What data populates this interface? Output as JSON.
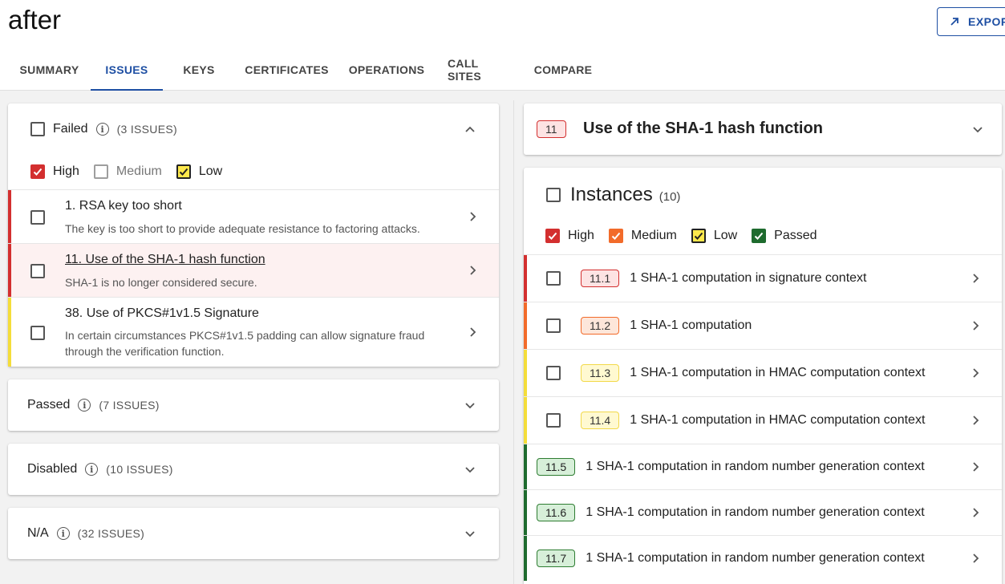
{
  "header": {
    "title": "after",
    "export_label": "EXPOR",
    "tabs": [
      {
        "label": "SUMMARY"
      },
      {
        "label": "ISSUES"
      },
      {
        "label": "KEYS"
      },
      {
        "label": "CERTIFICATES"
      },
      {
        "label": "OPERATIONS"
      },
      {
        "label": "CALL SITES"
      },
      {
        "label": "COMPARE"
      }
    ],
    "active_tab": "ISSUES"
  },
  "left": {
    "failed": {
      "label": "Failed",
      "count": "(3 ISSUES)",
      "filters": [
        {
          "label": "High",
          "checked": true
        },
        {
          "label": "Medium",
          "checked": false
        },
        {
          "label": "Low",
          "checked": true
        }
      ],
      "issues": [
        {
          "title": "1. RSA key too short",
          "desc": "The key is too short to provide adequate resistance to factoring attacks.",
          "severity": "high"
        },
        {
          "title": "11. Use of the SHA-1 hash function",
          "desc": "SHA-1 is no longer considered secure.",
          "severity": "high",
          "selected": true
        },
        {
          "title": "38. Use of PKCS#1v1.5 Signature",
          "desc": "In certain circumstances PKCS#1v1.5 padding can allow signature fraud through the verification function.",
          "severity": "low"
        }
      ]
    },
    "passed": {
      "label": "Passed",
      "count": "(7 ISSUES)"
    },
    "disabled": {
      "label": "Disabled",
      "count": "(10 ISSUES)"
    },
    "na": {
      "label": "N/A",
      "count": "(32 ISSUES)"
    }
  },
  "right": {
    "detail": {
      "badge": "11",
      "title": "Use of the SHA-1 hash function"
    },
    "instances": {
      "label": "Instances",
      "count": "(10)",
      "filters": [
        {
          "label": "High",
          "checked": true
        },
        {
          "label": "Medium",
          "checked": true
        },
        {
          "label": "Low",
          "checked": true
        },
        {
          "label": "Passed",
          "checked": true
        }
      ],
      "items": [
        {
          "badge": "11.1",
          "text": "1 SHA-1 computation in signature context",
          "severity": "high"
        },
        {
          "badge": "11.2",
          "text": "1 SHA-1 computation",
          "severity": "medium"
        },
        {
          "badge": "11.3",
          "text": "1 SHA-1 computation in HMAC computation context",
          "severity": "low"
        },
        {
          "badge": "11.4",
          "text": "1 SHA-1 computation in HMAC computation context",
          "severity": "low"
        },
        {
          "badge": "11.5",
          "text": "1 SHA-1 computation in random number generation context",
          "severity": "passed"
        },
        {
          "badge": "11.6",
          "text": "1 SHA-1 computation in random number generation context",
          "severity": "passed"
        },
        {
          "badge": "11.7",
          "text": "1 SHA-1 computation in random number generation context",
          "severity": "passed"
        }
      ]
    }
  },
  "colors": {
    "accent": "#1e4fa3",
    "high": "#d32f2f",
    "medium": "#f26b2a",
    "low": "#fde84c",
    "passed": "#1e6b2e"
  }
}
